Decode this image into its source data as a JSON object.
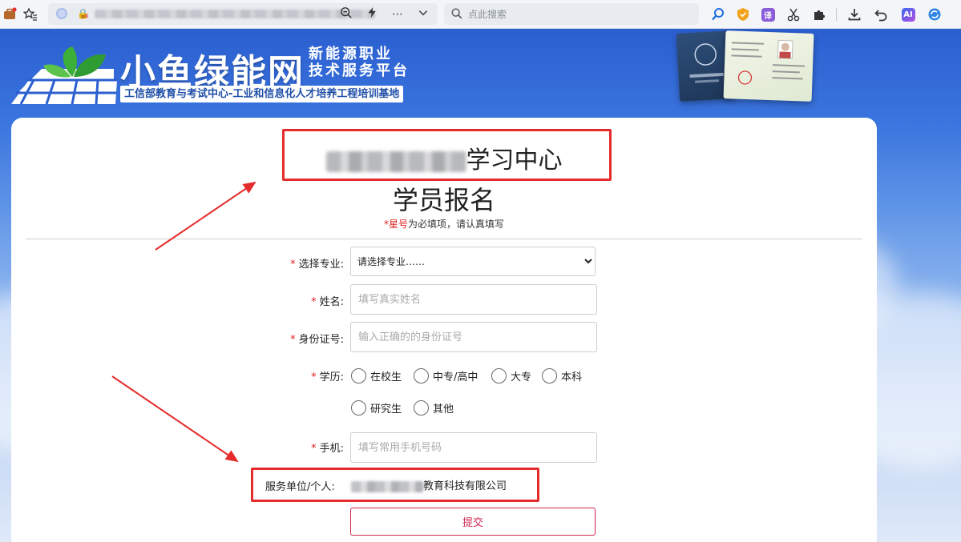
{
  "browser": {
    "search_placeholder": "点此搜索",
    "translate_badge": "译",
    "ai_badge": "AI"
  },
  "banner": {
    "title": "小鱼绿能网",
    "subtitle_line1": "新能源职业",
    "subtitle_line2": "技术服务平台",
    "tagline": "工信部教育与考试中心-工业和信息化人才培养工程培训基地"
  },
  "form": {
    "center_title_suffix": "学习中心",
    "signup_title": "学员报名",
    "note_red": "*星号",
    "note_rest": "为必填项，请认真填写",
    "major_label": "选择专业:",
    "major_selected": "请选择专业……",
    "name_label": "姓名:",
    "name_placeholder": "填写真实姓名",
    "id_label": "身份证号:",
    "id_placeholder": "输入正确的的身份证号",
    "edu_label": "学历:",
    "edu_options": [
      "在校生",
      "中专/高中",
      "大专",
      "本科",
      "研究生",
      "其他"
    ],
    "phone_label": "手机:",
    "phone_placeholder": "填写常用手机号码",
    "service_label": "服务单位/个人:",
    "service_value_suffix": "教育科技有限公司",
    "submit_label": "提交"
  },
  "colors": {
    "annotation": "#e52b2b",
    "required_star": "#e02020",
    "submit_accent": "#d0264e"
  }
}
